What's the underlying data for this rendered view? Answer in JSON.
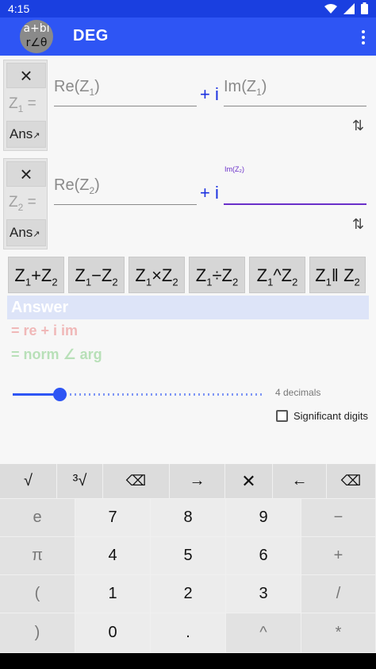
{
  "status_bar": {
    "time": "4:15"
  },
  "app_bar": {
    "icon_line1": "a+bi",
    "icon_line2": "r∠θ",
    "title": "DEG"
  },
  "z1": {
    "clear_label": "×",
    "label_prefix": "Z",
    "label_sub": "1",
    "label_suffix": " =",
    "ans_label": "Ans",
    "ans_arrow": "↗",
    "re_placeholder_prefix": "Re(Z",
    "re_placeholder_sub": "1",
    "re_placeholder_suffix": ")",
    "plus_i": "+ i",
    "im_placeholder_prefix": "Im(Z",
    "im_placeholder_sub": "1",
    "im_placeholder_suffix": ")",
    "swap": "⇅"
  },
  "z2": {
    "clear_label": "×",
    "label_prefix": "Z",
    "label_sub": "2",
    "label_suffix": " =",
    "ans_label": "Ans",
    "ans_arrow": "↗",
    "re_placeholder_prefix": "Re(Z",
    "re_placeholder_sub": "2",
    "re_placeholder_suffix": ")",
    "plus_i": "+ i",
    "im_float_label": "Im(Z₂)",
    "swap": "⇅"
  },
  "operations": [
    {
      "a": "Z",
      "a_sub": "1",
      "op": "+",
      "b": "Z",
      "b_sub": "2"
    },
    {
      "a": "Z",
      "a_sub": "1",
      "op": "−",
      "b": "Z",
      "b_sub": "2"
    },
    {
      "a": "Z",
      "a_sub": "1",
      "op": "×",
      "b": "Z",
      "b_sub": "2"
    },
    {
      "a": "Z",
      "a_sub": "1",
      "op": "÷",
      "b": "Z",
      "b_sub": "2"
    },
    {
      "a": "Z",
      "a_sub": "1",
      "op": "^",
      "b": "Z",
      "b_sub": "2"
    },
    {
      "a": "Z",
      "a_sub": "1",
      "op": "‖ ",
      "b": "Z",
      "b_sub": "2"
    }
  ],
  "answer": {
    "header": "Answer",
    "rect_form": "= re + i im",
    "polar_form": "= norm ∠ arg"
  },
  "precision": {
    "decimals_label": "4 decimals",
    "slider_fraction": 0.19,
    "significant_digits_label": "Significant digits",
    "significant_digits_checked": false
  },
  "keyboard": {
    "top_row": [
      "√",
      "³√",
      "⌫",
      "→",
      "✕",
      "←",
      "⌫"
    ],
    "rows": [
      [
        "e",
        "7",
        "8",
        "9",
        "−"
      ],
      [
        "π",
        "4",
        "5",
        "6",
        "+"
      ],
      [
        "(",
        "1",
        "2",
        "3",
        "/"
      ],
      [
        ")",
        "0",
        ".",
        "^",
        "*"
      ]
    ]
  },
  "colors": {
    "status_bar": "#1a3fe0",
    "app_bar": "#2e55f4",
    "accent_blue": "#1a30e0",
    "focus_purple": "#6a2fc9",
    "red": "#e02020"
  }
}
